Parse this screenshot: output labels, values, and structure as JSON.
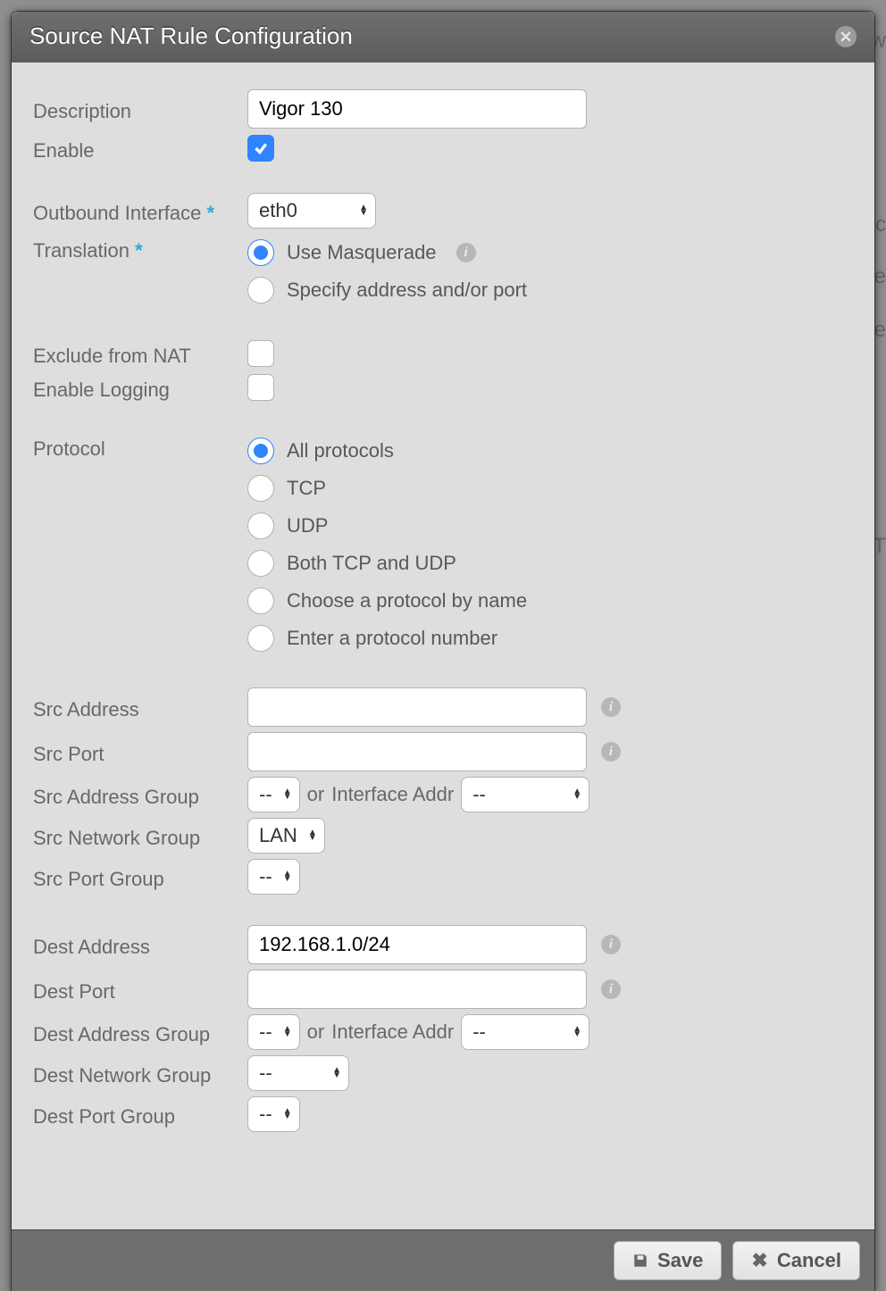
{
  "dialog": {
    "title": "Source NAT Rule Configuration"
  },
  "labels": {
    "description": "Description",
    "enable": "Enable",
    "outbound_interface": "Outbound Interface",
    "translation": "Translation",
    "exclude_nat": "Exclude from NAT",
    "enable_logging": "Enable Logging",
    "protocol": "Protocol",
    "src_address": "Src Address",
    "src_port": "Src Port",
    "src_addr_group": "Src Address Group",
    "src_net_group": "Src Network Group",
    "src_port_group": "Src Port Group",
    "dest_address": "Dest Address",
    "dest_port": "Dest Port",
    "dest_addr_group": "Dest Address Group",
    "dest_net_group": "Dest Network Group",
    "dest_port_group": "Dest Port Group",
    "or": "or",
    "iface_addr": "Interface Addr"
  },
  "values": {
    "description": "Vigor 130",
    "enable": true,
    "outbound_interface": "eth0",
    "exclude_nat": false,
    "enable_logging": false,
    "src_address": "",
    "src_port": "",
    "src_addr_group": "--",
    "src_iface_addr": "--",
    "src_net_group": "LAN",
    "src_port_group": "--",
    "dest_address": "192.168.1.0/24",
    "dest_port": "",
    "dest_addr_group": "--",
    "dest_iface_addr": "--",
    "dest_net_group": "--",
    "dest_port_group": "--"
  },
  "translation": {
    "selected": "masquerade",
    "options": {
      "masquerade": "Use Masquerade",
      "specify": "Specify address and/or port"
    }
  },
  "protocol": {
    "selected": "all",
    "options": {
      "all": "All protocols",
      "tcp": "TCP",
      "udp": "UDP",
      "both": "Both TCP and UDP",
      "byname": "Choose a protocol by name",
      "bynumber": "Enter a protocol number"
    }
  },
  "footer": {
    "save": "Save",
    "cancel": "Cancel"
  },
  "bg": {
    "t1": "ew",
    "t2": "tic",
    "t3": "e",
    "t4": "e",
    "t5": "T"
  }
}
